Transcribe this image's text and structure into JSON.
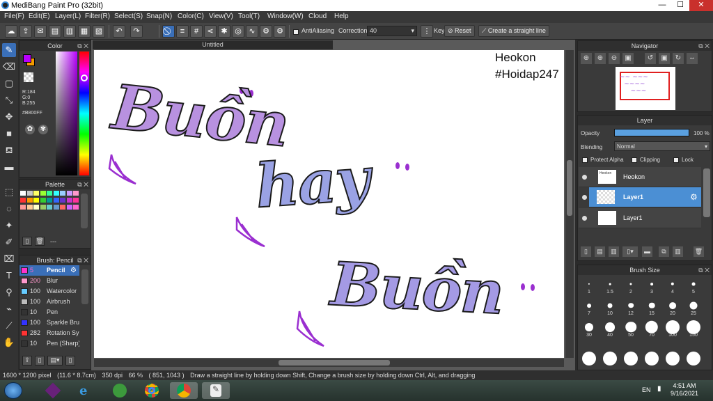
{
  "window": {
    "title": "MediBang Paint Pro (32bit)",
    "minimize": "—",
    "maximize": "☐",
    "close": "✕"
  },
  "menu": [
    "File(F)",
    "Edit(E)",
    "Layer(L)",
    "Filter(R)",
    "Select(S)",
    "Snap(N)",
    "Color(C)",
    "View(V)",
    "Tool(T)",
    "Window(W)",
    "Cloud",
    "Help"
  ],
  "toolbar": {
    "antialiasing_label": "AntiAliasing",
    "correction_label": "Correction",
    "correction_value": "40",
    "key_label": "Key",
    "reset_label": "Reset",
    "straight_line_label": "Create a straight line"
  },
  "color_panel": {
    "title": "Color",
    "r": "R:184",
    "g": "G:0",
    "b": "B:255",
    "hex": "#B800FF",
    "primary_color": "#B800FF",
    "secondary_color": "#F59A00"
  },
  "palette_panel": {
    "title": "Palette",
    "dash": "---",
    "colors": [
      "#ffffff",
      "#c8c8c8",
      "#ffff66",
      "#99ff33",
      "#33ff99",
      "#33ffff",
      "#99ccff",
      "#cc99ff",
      "#ff99cc",
      "#ff3333",
      "#ff9900",
      "#ffff00",
      "#33cc33",
      "#009999",
      "#3366ff",
      "#6633cc",
      "#cc33cc",
      "#ff3399",
      "#ff9999",
      "#ffcc99",
      "#ffffcc",
      "#99cc66",
      "#66cccc",
      "#6699cc",
      "#ff6666",
      "#cc66ff",
      "#ff66cc"
    ]
  },
  "brush_panel": {
    "title": "Brush: Pencil",
    "items": [
      {
        "size": "5",
        "name": "Pencil",
        "color": "#ff33cc"
      },
      {
        "size": "200",
        "name": "Blur",
        "color": "#ff99cc"
      },
      {
        "size": "100",
        "name": "Watercolor",
        "color": "#66ccff"
      },
      {
        "size": "100",
        "name": "Airbrush",
        "color": "#bbbbbb"
      },
      {
        "size": "10",
        "name": "Pen",
        "color": "#333333"
      },
      {
        "size": "100",
        "name": "Sparkle Brush",
        "color": "#3333ff"
      },
      {
        "size": "282",
        "name": "Rotation Sym",
        "color": "#ff3333"
      },
      {
        "size": "10",
        "name": "Pen (Sharp)",
        "color": "#333333"
      }
    ]
  },
  "document": {
    "tab_title": "Untitled"
  },
  "canvas_text": {
    "watermark_line1": "Heokon",
    "watermark_line2": "#Hoidap247",
    "word1": "Buồn",
    "word2": "hay",
    "word3": "Buồn"
  },
  "navigator": {
    "title": "Navigator"
  },
  "layer_panel": {
    "title": "Layer",
    "opacity_label": "Opacity",
    "opacity_value": "100 %",
    "opacity": 1.0,
    "blending_label": "Blending",
    "blending_value": "Normal",
    "protect_alpha": "Protect Alpha",
    "clipping": "Clipping",
    "lock": "Lock",
    "layers": [
      {
        "name": "Heokon"
      },
      {
        "name": "Layer1"
      },
      {
        "name": "Layer1"
      }
    ]
  },
  "brush_size_panel": {
    "title": "Brush Size",
    "sizes": [
      "1",
      "1.5",
      "2",
      "3",
      "4",
      "5",
      "7",
      "10",
      "12",
      "15",
      "20",
      "25",
      "30",
      "40",
      "50",
      "70",
      "100",
      "150"
    ]
  },
  "status": {
    "dimensions": "1600 * 1200 pixel",
    "physical": "(11.6 * 8.7cm)",
    "dpi": "350 dpi",
    "zoom": "66 %",
    "coords": "( 851, 1043 )",
    "hint": "Draw a straight line by holding down Shift, Change a brush size by holding down Ctrl, Alt, and dragging"
  },
  "taskbar": {
    "lang": "EN",
    "time": "4:51 AM",
    "date": "9/16/2021"
  }
}
